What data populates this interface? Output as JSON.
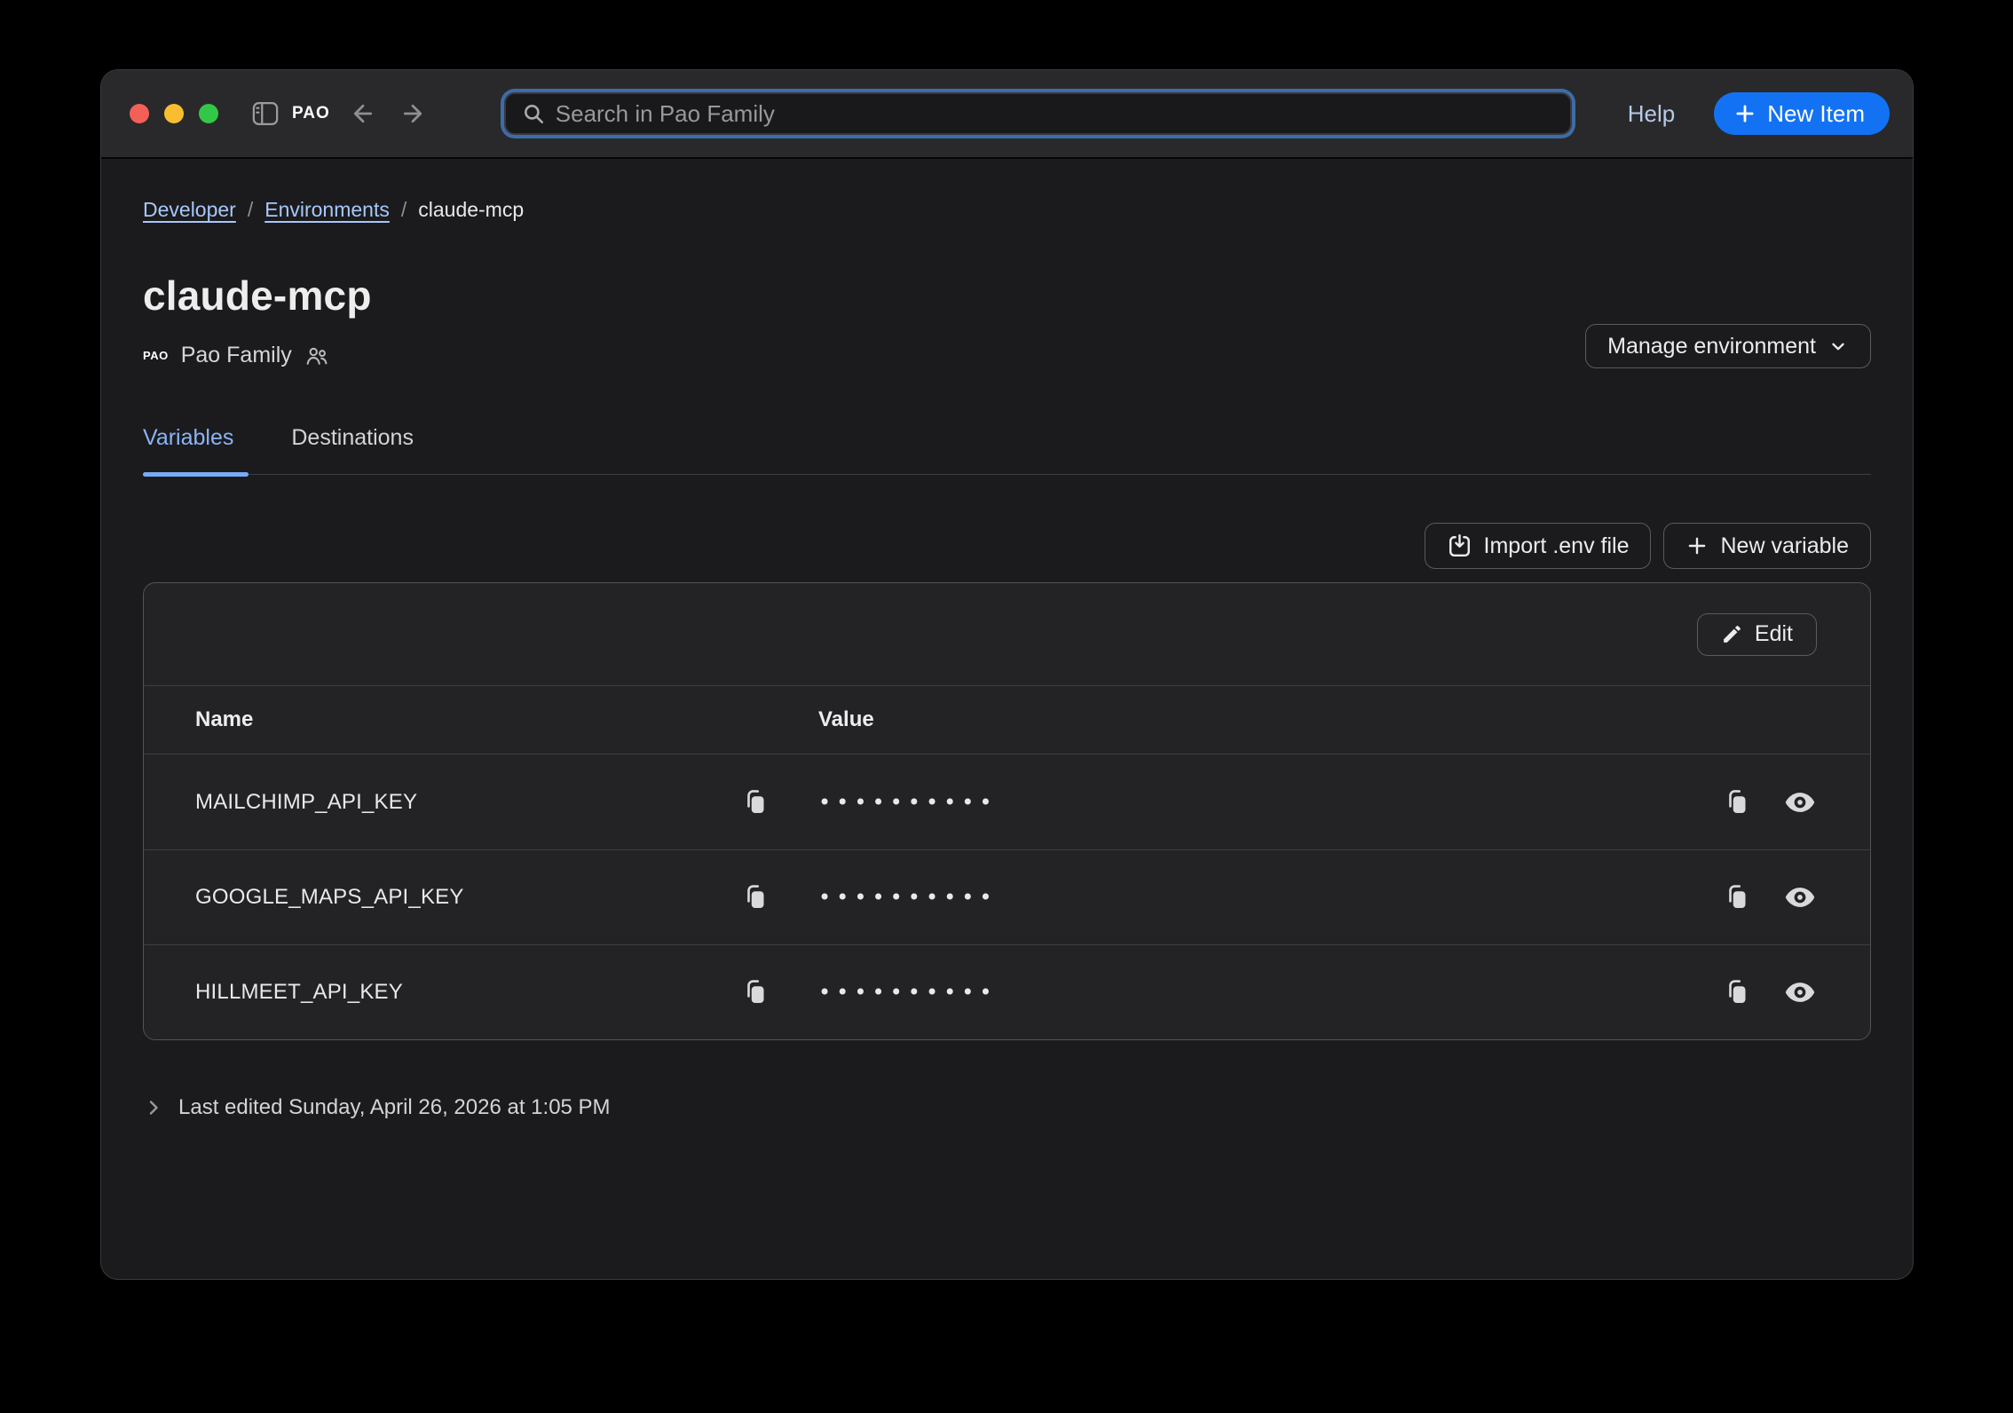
{
  "window_chrome": {
    "logo": "PAO",
    "search": {
      "placeholder": "Search in Pao Family"
    },
    "help_label": "Help",
    "new_item_label": "New Item"
  },
  "breadcrumb": {
    "separator": "/",
    "items": [
      {
        "label": "Developer"
      },
      {
        "label": "Environments"
      },
      {
        "label": "claude-mcp"
      }
    ]
  },
  "page": {
    "title": "claude-mcp",
    "vault_badge": "PAO",
    "vault_name": "Pao Family",
    "manage_button_label": "Manage environment"
  },
  "tabs": [
    {
      "label": "Variables",
      "active": true
    },
    {
      "label": "Destinations",
      "active": false
    }
  ],
  "actions": {
    "import_label": "Import .env file",
    "new_variable_label": "New variable",
    "edit_label": "Edit"
  },
  "table": {
    "columns": {
      "name": "Name",
      "value": "Value"
    },
    "rows": [
      {
        "name": "MAILCHIMP_API_KEY",
        "value_masked": "••••••••••"
      },
      {
        "name": "GOOGLE_MAPS_API_KEY",
        "value_masked": "••••••••••"
      },
      {
        "name": "HILLMEET_API_KEY",
        "value_masked": "••••••••••"
      }
    ]
  },
  "footer": {
    "last_edited": "Last edited Sunday, April 26, 2026 at 1:05 PM"
  },
  "icons": [
    "sidebar-toggle-icon",
    "search-icon",
    "back-arrow-icon",
    "forward-arrow-icon",
    "plus-icon",
    "people-icon",
    "chevron-down-icon",
    "import-download-icon",
    "pencil-icon",
    "copy-icon",
    "eye-icon",
    "chevron-right-icon"
  ],
  "colors": {
    "accent_blue": "#1372f4",
    "link_blue": "#a8c7fa",
    "tab_active_blue": "#8ab4f8",
    "traffic_red": "#f45f58",
    "traffic_yellow": "#f9be30",
    "traffic_green": "#33c748"
  }
}
